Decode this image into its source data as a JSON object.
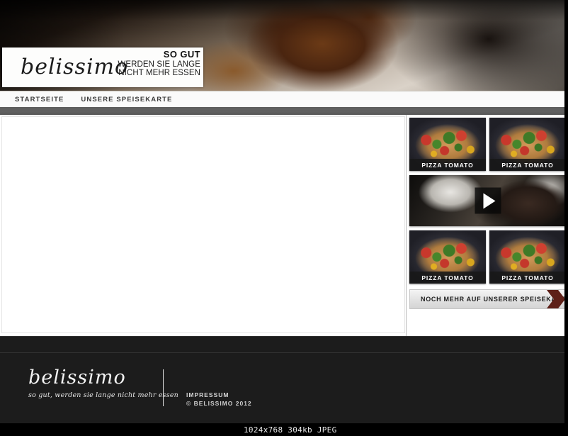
{
  "site": {
    "brand": "belissimo",
    "tagline_line1": "SO GUT",
    "tagline_line2": "WERDEN SIE LANGE",
    "tagline_line3": "NICHT MEHR ESSEN"
  },
  "nav": {
    "items": [
      {
        "label": "STARTSEITE"
      },
      {
        "label": "UNSERE SPEISEKARTE"
      }
    ]
  },
  "sidebar": {
    "thumbnails": [
      {
        "caption": "PIZZA TOMATO"
      },
      {
        "caption": "PIZZA TOMATO"
      },
      {
        "caption": "PIZZA TOMATO"
      },
      {
        "caption": "PIZZA TOMATO"
      }
    ],
    "video": {
      "play_label": "play"
    },
    "cta": {
      "label": "NOCH MEHR AUF UNSERER SPEISEKARTE",
      "arrow_color": "#5e2018"
    }
  },
  "footer": {
    "logo": "belissimo",
    "tagline": "so gut, werden sie lange nicht mehr essen",
    "impressum_label": "IMPRESSUM",
    "copyright": "© BELISSIMO 2012"
  },
  "viewer": {
    "status": "1024x768 304kb JPEG"
  },
  "colors": {
    "page_background": "#ffffff",
    "footer_background": "#1c1c1c",
    "nav_shadow": "#5e5e5e",
    "accent_dark_red": "#5e2018",
    "viewer_background": "#000000"
  }
}
